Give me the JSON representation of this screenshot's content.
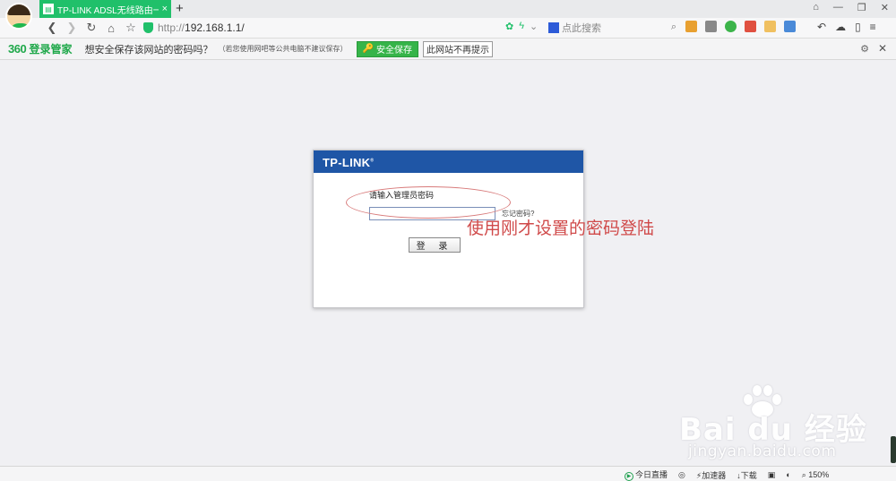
{
  "tab": {
    "title": "TP-LINK ADSL无线路由一体机",
    "new_tab": "+",
    "close": "×"
  },
  "window_controls": [
    "⌂",
    "—",
    "❐",
    "✕"
  ],
  "toolbar": {
    "url_protocol": "http://",
    "url_host": "192.168.1.1/",
    "search_placeholder": "点此搜索"
  },
  "password_bar": {
    "brand_360": "360",
    "brand_name": "登录管家",
    "question": "想安全保存该网站的密码吗？",
    "note": "（若您使用网吧等公共电脑不建议保存）",
    "save_button": "安全保存",
    "never_button": "此网站不再提示"
  },
  "login_panel": {
    "logo": "TP-LINK",
    "logo_mark": "®",
    "prompt": "请输入管理员密码",
    "forgot": "忘记密码?",
    "login_button": "登 录"
  },
  "annotation": "使用刚才设置的密码登陆",
  "watermark": {
    "brand": "Bai  du 经验",
    "url": "jingyan.baidu.com"
  },
  "statusbar": {
    "live": "今日直播",
    "accelerator": "加速器",
    "download": "下载",
    "zoom": "150%"
  },
  "colors": {
    "tab_green": "#20c06a",
    "tplink_blue": "#1f56a6",
    "save_green": "#36b449",
    "annotation_red": "#d04a4a"
  }
}
